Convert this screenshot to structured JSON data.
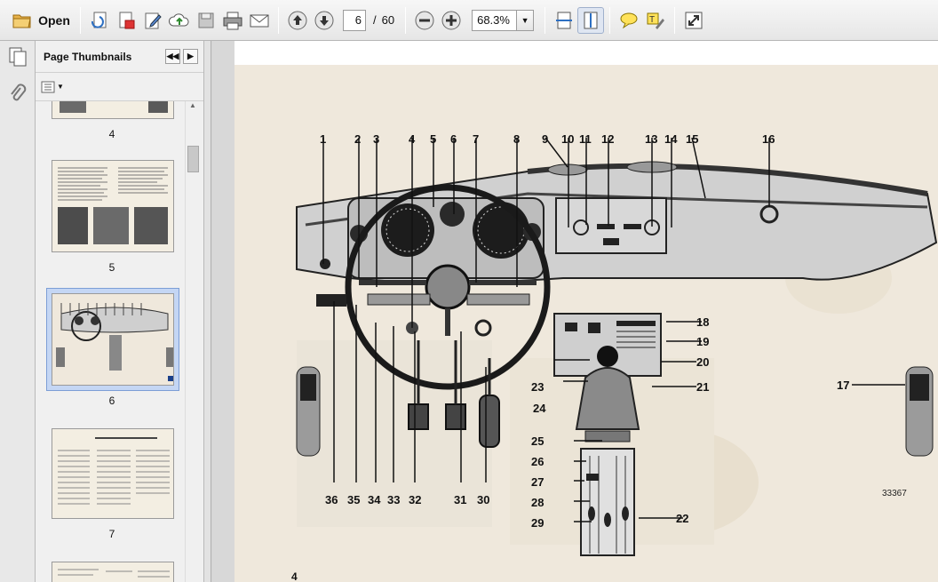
{
  "toolbar": {
    "open_label": "Open",
    "current_page": "6",
    "page_separator": "/",
    "total_pages": "60",
    "zoom": "68.3%"
  },
  "sidebar": {
    "title": "Page Thumbnails",
    "thumbnails": [
      {
        "label": "4"
      },
      {
        "label": "5"
      },
      {
        "label": "6",
        "selected": true
      },
      {
        "label": "7"
      }
    ]
  },
  "document": {
    "page_number": "4",
    "figure_number": "33367",
    "callouts_top": [
      "1",
      "2",
      "3",
      "4",
      "5",
      "6",
      "7",
      "8",
      "9",
      "10",
      "11",
      "12",
      "13",
      "14",
      "15",
      "16"
    ],
    "callouts_right": [
      "18",
      "19",
      "20",
      "21",
      "17"
    ],
    "callouts_left": [
      "23",
      "24",
      "25",
      "26",
      "27",
      "28",
      "29",
      "22"
    ],
    "callouts_bottom": [
      "36",
      "35",
      "34",
      "33",
      "32",
      "31",
      "30"
    ]
  }
}
